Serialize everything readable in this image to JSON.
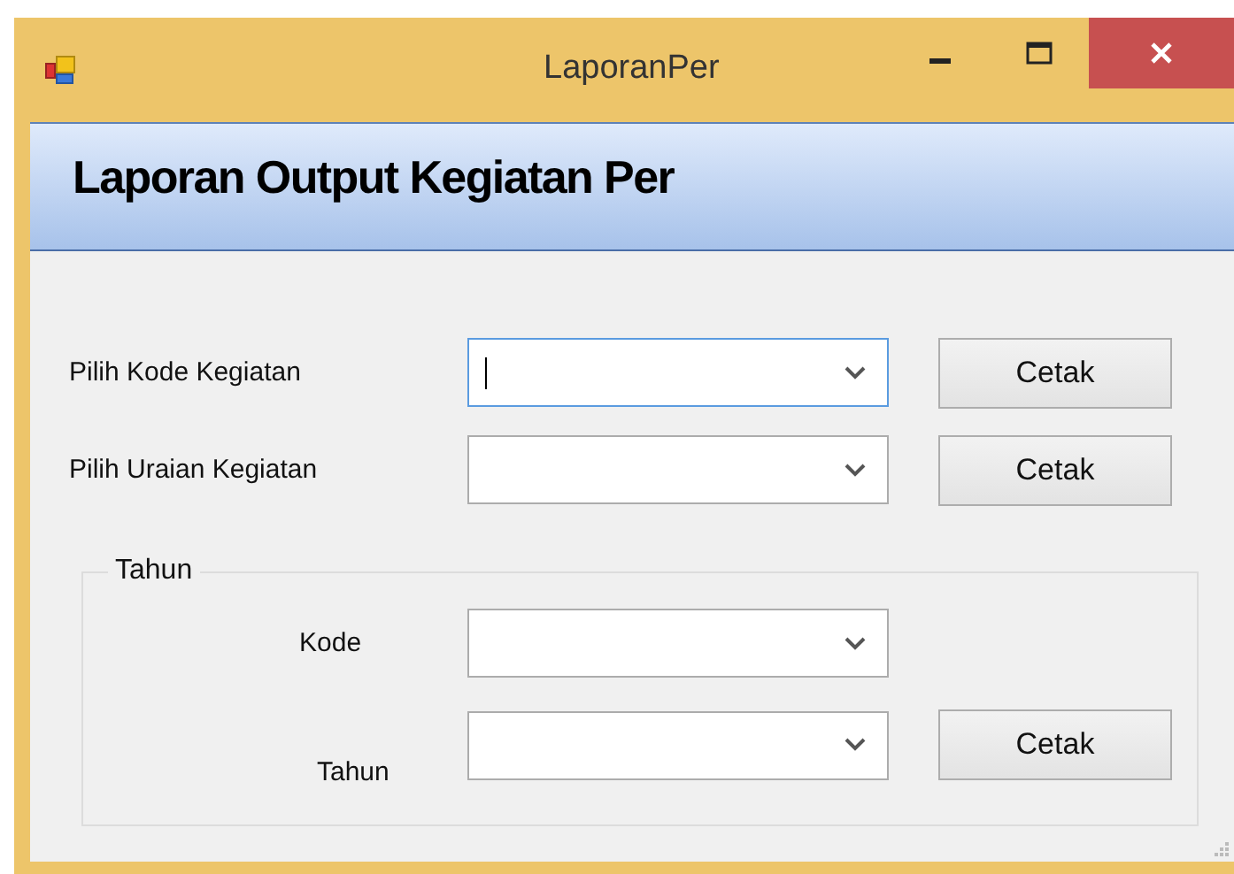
{
  "window": {
    "title": "LaporanPer"
  },
  "header": {
    "title": "Laporan Output Kegiatan Per"
  },
  "rows": [
    {
      "label": "Pilih Kode Kegiatan",
      "focused": true,
      "button": "Cetak"
    },
    {
      "label": "Pilih Uraian Kegiatan",
      "focused": false,
      "button": "Cetak"
    }
  ],
  "group": {
    "legend": "Tahun",
    "rows": [
      {
        "label": "Kode",
        "focused": false
      },
      {
        "label": "Tahun",
        "focused": false,
        "button": "Cetak"
      }
    ]
  }
}
